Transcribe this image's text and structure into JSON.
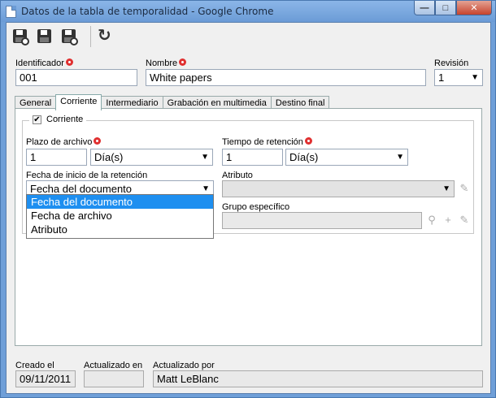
{
  "window": {
    "title": "Datos de la tabla de temporalidad - Google Chrome",
    "min_label": "—",
    "max_label": "□",
    "close_label": "✕"
  },
  "toolbar": {
    "buttons": [
      {
        "name": "save-new",
        "icon": "floppy-plus-icon"
      },
      {
        "name": "save",
        "icon": "floppy-icon"
      },
      {
        "name": "save-close",
        "icon": "floppy-close-icon"
      },
      {
        "name": "refresh",
        "icon": "refresh-icon",
        "glyph": "↻"
      }
    ]
  },
  "header": {
    "identificador_label": "Identificador",
    "identificador_value": "001",
    "nombre_label": "Nombre",
    "nombre_value": "White papers",
    "revision_label": "Revisión",
    "revision_value": "1"
  },
  "tabs": [
    {
      "label": "General",
      "active": false
    },
    {
      "label": "Corriente",
      "active": true
    },
    {
      "label": "Intermediario",
      "active": false
    },
    {
      "label": "Grabación en multimedia",
      "active": false
    },
    {
      "label": "Destino final",
      "active": false
    }
  ],
  "corriente": {
    "group_label": "Corriente",
    "checked": true,
    "check_glyph": "✔",
    "plazo_label": "Plazo de archivo",
    "plazo_value": "1",
    "plazo_unit": "Día(s)",
    "tiempo_label": "Tiempo de retención",
    "tiempo_value": "1",
    "tiempo_unit": "Día(s)",
    "fecha_label": "Fecha de inicio de la retención",
    "fecha_value": "Fecha del documento",
    "fecha_options": [
      "Fecha del documento",
      "Fecha de archivo",
      "Atributo"
    ],
    "atributo_label": "Atributo",
    "atributo_value": "",
    "grupo_label": "Grupo específico",
    "grupo_value": ""
  },
  "footer": {
    "creado_label": "Creado el",
    "creado_value": "09/11/2011",
    "actualizado_en_label": "Actualizado en",
    "actualizado_en_value": "",
    "actualizado_por_label": "Actualizado por",
    "actualizado_por_value": "Matt LeBlanc"
  },
  "colors": {
    "titlebar": "#6b9bd6",
    "required": "#e03030",
    "selection": "#1e8ff0"
  }
}
